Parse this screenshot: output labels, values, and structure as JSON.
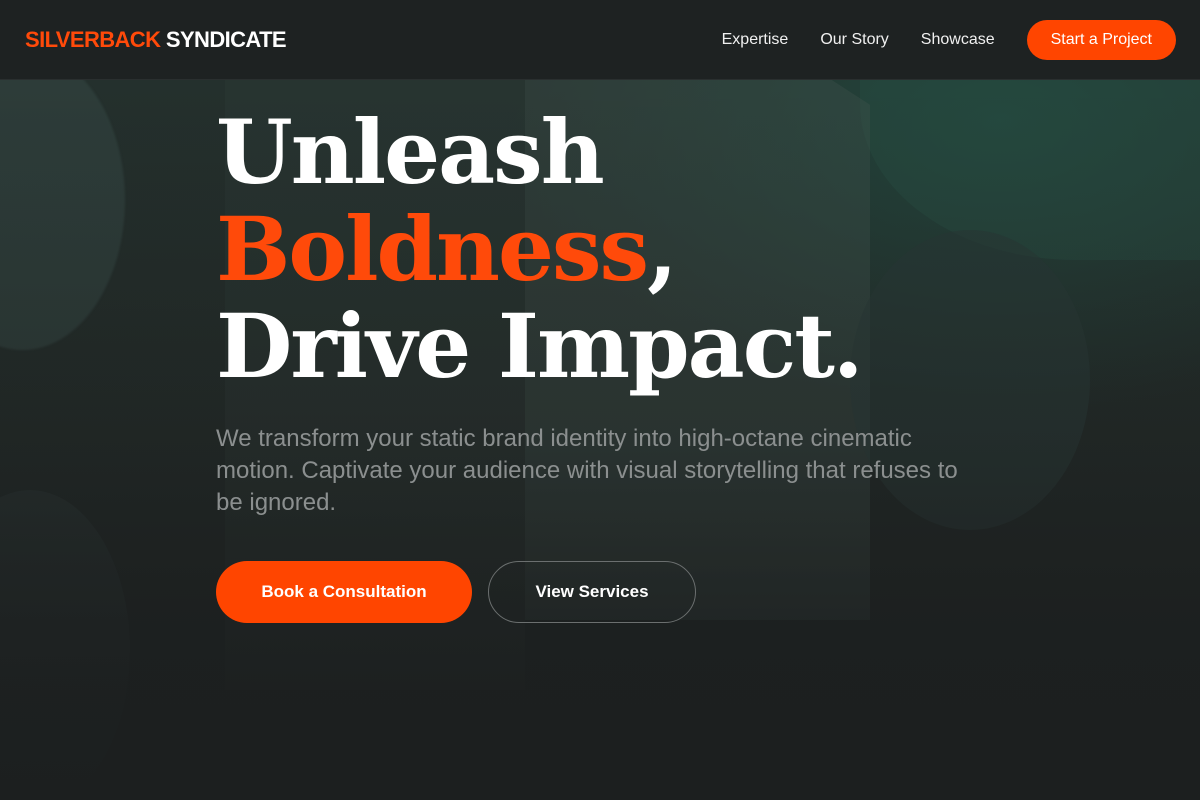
{
  "header": {
    "logo_accent": "SILVERBACK",
    "logo_rest": " SYNDICATE",
    "nav": [
      "Expertise",
      "Our Story",
      "Showcase"
    ],
    "cta_label": "Start a Project"
  },
  "hero": {
    "headline_line1": "Unleash",
    "headline_accent": "Boldness",
    "headline_comma": ",",
    "headline_line3": "Drive Impact.",
    "subtext": "We transform your static brand identity into high-octane cinematic motion. Captivate your audience with visual storytelling that refuses to be ignored.",
    "primary_button": "Book a Consultation",
    "secondary_button": "View Services"
  },
  "colors": {
    "accent": "#ff4500",
    "background": "#1c1f1f",
    "header_bg": "#1e2222",
    "subtext": "#8b8f8f"
  }
}
